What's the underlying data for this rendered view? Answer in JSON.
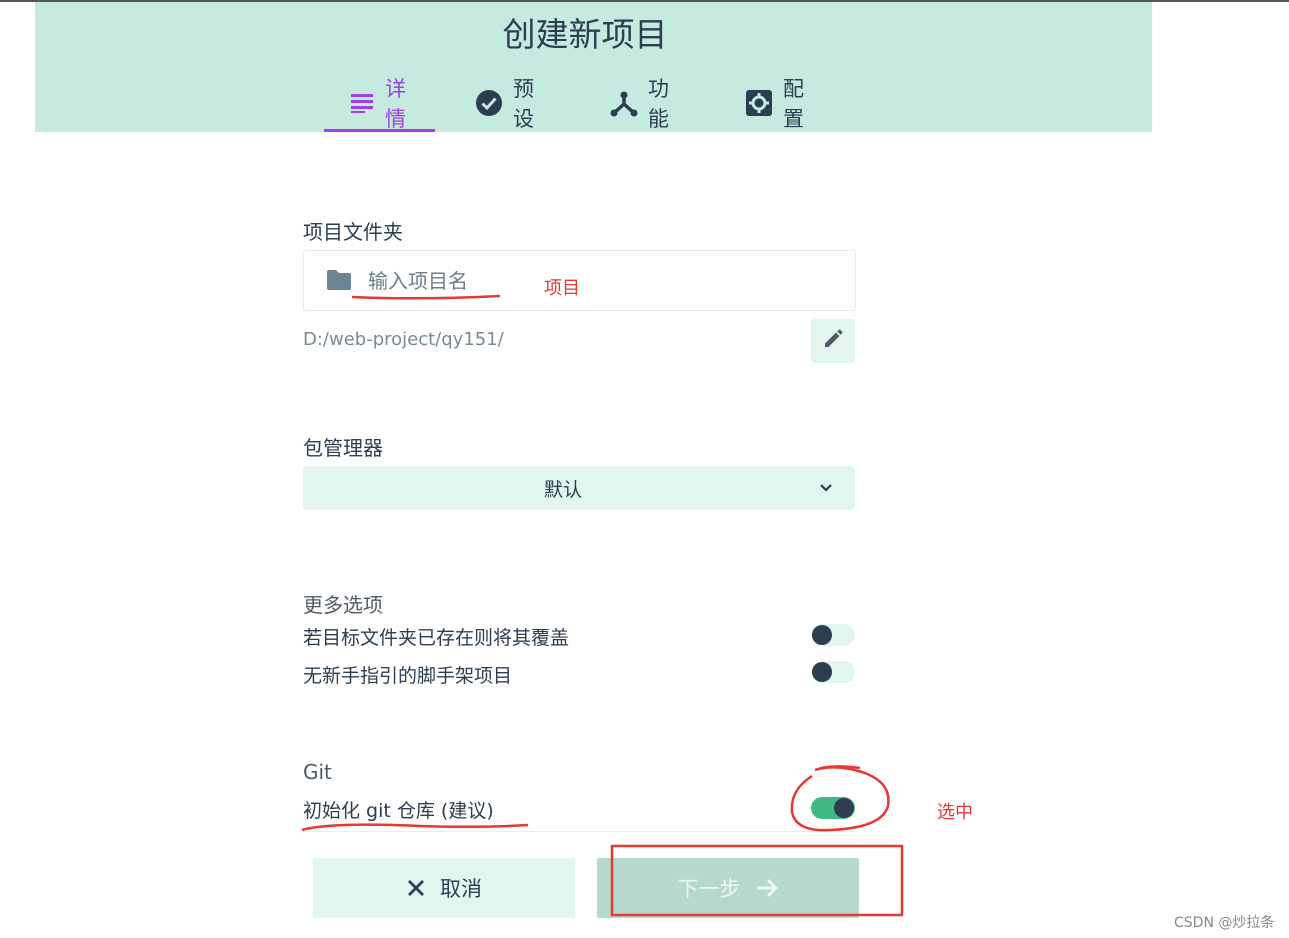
{
  "header": {
    "title": "创建新项目",
    "tabs": [
      {
        "label": "详情",
        "icon": "list-icon",
        "active": true
      },
      {
        "label": "预设",
        "icon": "check-circle-icon",
        "active": false
      },
      {
        "label": "功能",
        "icon": "fork-icon",
        "active": false
      },
      {
        "label": "配置",
        "icon": "gear-box-icon",
        "active": false
      }
    ]
  },
  "folder": {
    "label": "项目文件夹",
    "input_value": "",
    "input_placeholder": "输入项目名",
    "path": "D:/web-project/qy151/"
  },
  "package_manager": {
    "label": "包管理器",
    "selected": "默认"
  },
  "more_options": {
    "label": "更多选项",
    "items": [
      {
        "label": "若目标文件夹已存在则将其覆盖",
        "enabled": false
      },
      {
        "label": "无新手指引的脚手架项目",
        "enabled": false
      }
    ]
  },
  "git": {
    "label": "Git",
    "init_label": "初始化 git 仓库 (建议)",
    "enabled": true
  },
  "footer": {
    "cancel_label": "取消",
    "next_label": "下一步"
  },
  "annotations": {
    "project_note": "项目",
    "selected_note": "选中",
    "color": "#e53935"
  },
  "watermark": "CSDN @炒拉条",
  "colors": {
    "header_bg": "#c5eadf",
    "accent": "#a040e6",
    "primary": "#42b983",
    "text": "#2c3e50"
  }
}
